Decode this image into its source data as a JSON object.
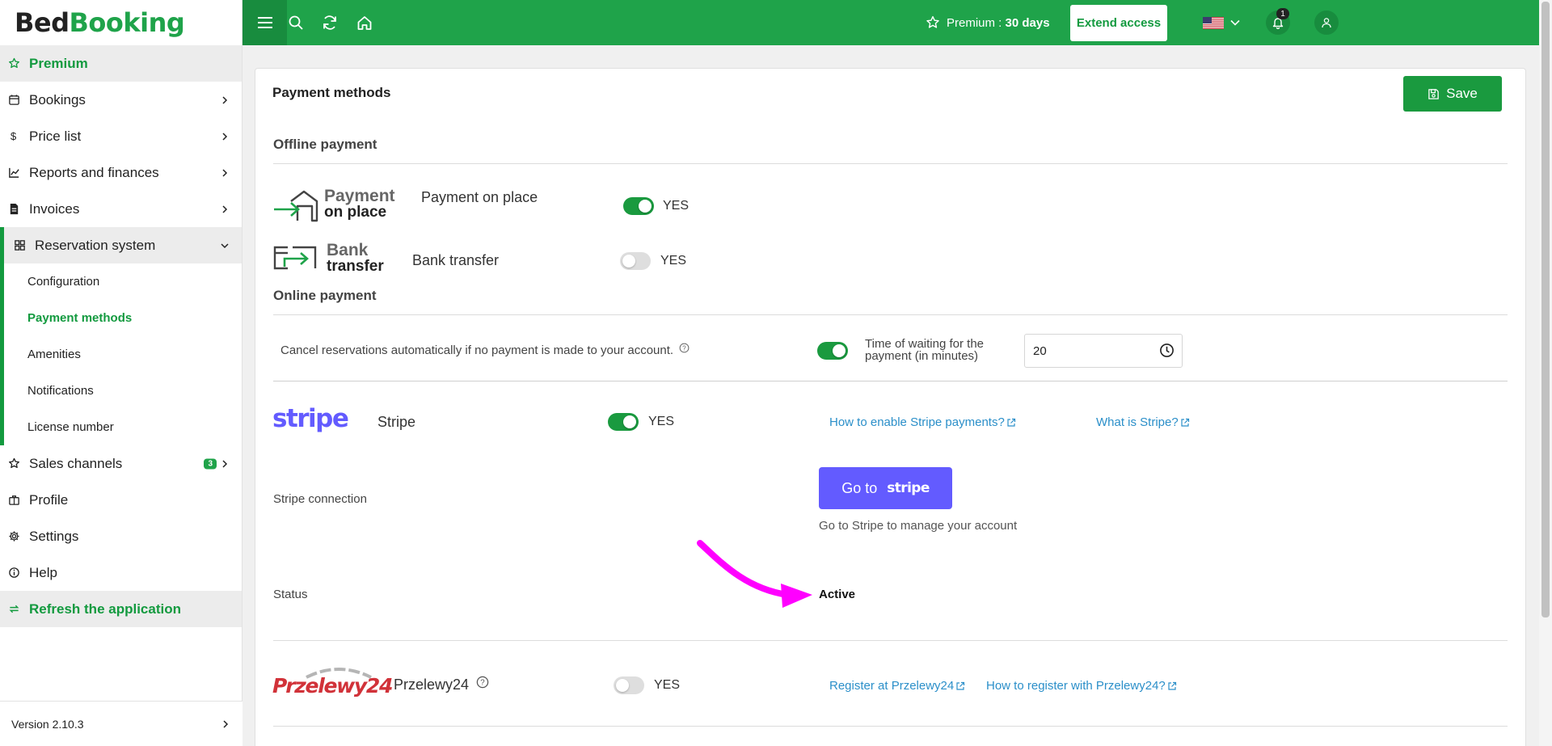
{
  "logo": {
    "part1": "Bed",
    "part2": "Booking"
  },
  "sidebar": {
    "items": [
      {
        "label": "Premium",
        "icon": "star-icon"
      },
      {
        "label": "Bookings",
        "icon": "calendar-icon"
      },
      {
        "label": "Price list",
        "icon": "dollar-icon"
      },
      {
        "label": "Reports and finances",
        "icon": "chart-icon"
      },
      {
        "label": "Invoices",
        "icon": "invoice-icon"
      },
      {
        "label": "Reservation system",
        "icon": "grid-icon"
      },
      {
        "label": "Sales channels",
        "icon": "star-icon",
        "badge": "3"
      },
      {
        "label": "Profile",
        "icon": "briefcase-icon"
      },
      {
        "label": "Settings",
        "icon": "gear-icon"
      },
      {
        "label": "Help",
        "icon": "info-icon"
      },
      {
        "label": "Refresh the application",
        "icon": "refresh-icon"
      }
    ],
    "subitems": [
      {
        "label": "Configuration"
      },
      {
        "label": "Payment methods"
      },
      {
        "label": "Amenities"
      },
      {
        "label": "Notifications"
      },
      {
        "label": "License number"
      }
    ],
    "version": "Version 2.10.3"
  },
  "topbar": {
    "premium_label": "Premium :",
    "premium_days": "30 days",
    "extend_label": "Extend access",
    "notification_count": "1",
    "accent": "#1fa34a"
  },
  "page": {
    "title": "Payment methods",
    "save_label": "Save",
    "offline_title": "Offline payment",
    "online_title": "Online payment",
    "yes_label": "YES",
    "payment_on_place": {
      "logo_line1": "Payment",
      "logo_line2": "on place",
      "label": "Payment on place",
      "enabled": true
    },
    "bank_transfer": {
      "logo_line1": "Bank",
      "logo_line2": "transfer",
      "label": "Bank transfer",
      "enabled": false
    },
    "cancel": {
      "text": "Cancel reservations automatically if no payment is made to your account.",
      "enabled": true,
      "wait_label": "Time of waiting for the payment (in minutes)",
      "wait_value": "20"
    },
    "stripe": {
      "logo": "stripe",
      "label": "Stripe",
      "enabled": true,
      "link1": "How to enable Stripe payments?",
      "link2": "What is Stripe?",
      "connection_label": "Stripe connection",
      "button_prefix": "Go to",
      "button_word": "stripe",
      "manage_text": "Go to Stripe to manage your account",
      "status_label": "Status",
      "status_value": "Active",
      "brand_color": "#635bff"
    },
    "przelewy": {
      "logo": "Przelewy24",
      "label": "Przelewy24",
      "enabled": false,
      "link1": "Register at Przelewy24",
      "link2": "How to register with Przelewy24?"
    },
    "annotation_color": "#ff00ff"
  }
}
